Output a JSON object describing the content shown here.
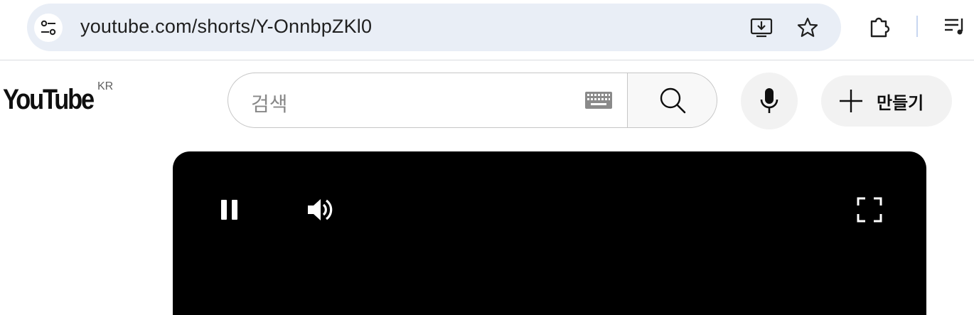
{
  "browser": {
    "url": "youtube.com/shorts/Y-OnnbpZKl0",
    "icons": [
      "tune-icon",
      "install-app-icon",
      "bookmark-star-icon",
      "extensions-icon",
      "reading-list-icon"
    ]
  },
  "youtube": {
    "logo_text": "YouTube",
    "country_code": "KR",
    "search": {
      "placeholder": "검색"
    },
    "create_label": "만들기",
    "icons": [
      "keyboard-icon",
      "search-icon",
      "microphone-icon",
      "plus-icon"
    ]
  },
  "player": {
    "state": "playing",
    "icons": [
      "pause-icon",
      "volume-icon",
      "fullscreen-icon"
    ]
  },
  "colors": {
    "omnibox_bg": "#e9eef6",
    "chip_bg": "#f2f2f2",
    "player_bg": "#000000",
    "text_primary": "#0f0f0f"
  }
}
